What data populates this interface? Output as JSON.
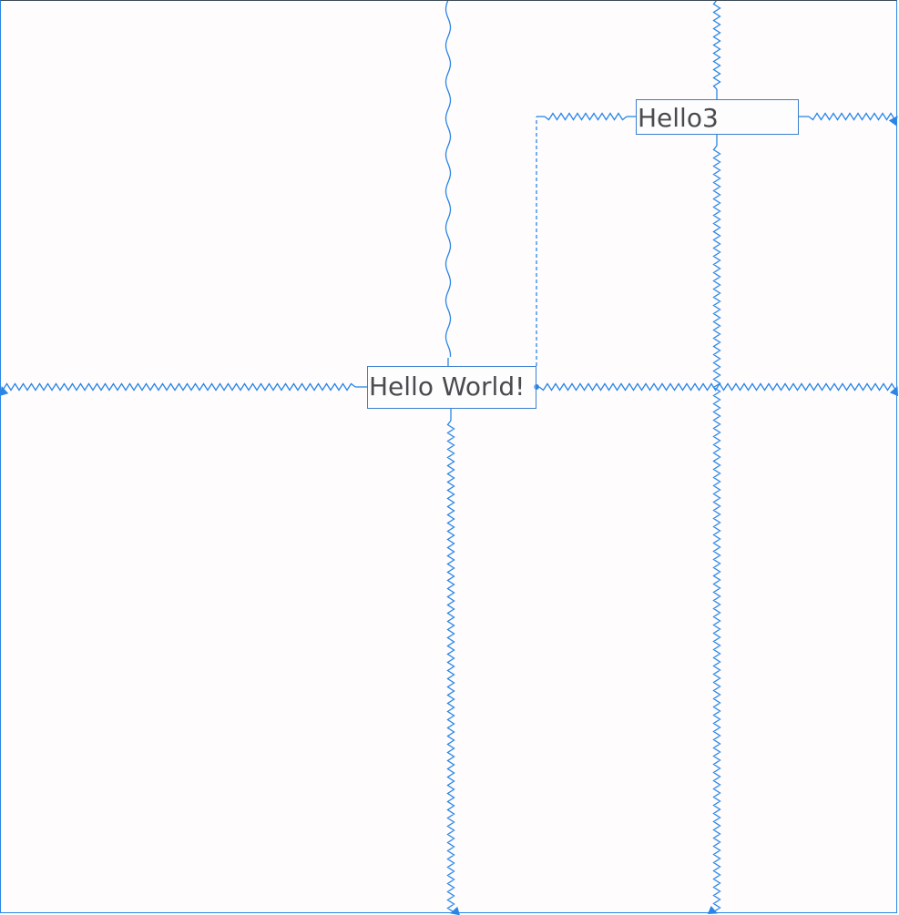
{
  "layout_editor": {
    "widgets": [
      {
        "id": "hello_world",
        "text": "Hello World!"
      },
      {
        "id": "hello3",
        "text": "Hello3"
      }
    ]
  },
  "colors": {
    "constraint": "#2a86e6",
    "canvas_background": "#fefcfd",
    "widget_text": "#4a4a4f",
    "widget_border": "#3c7fd0"
  }
}
